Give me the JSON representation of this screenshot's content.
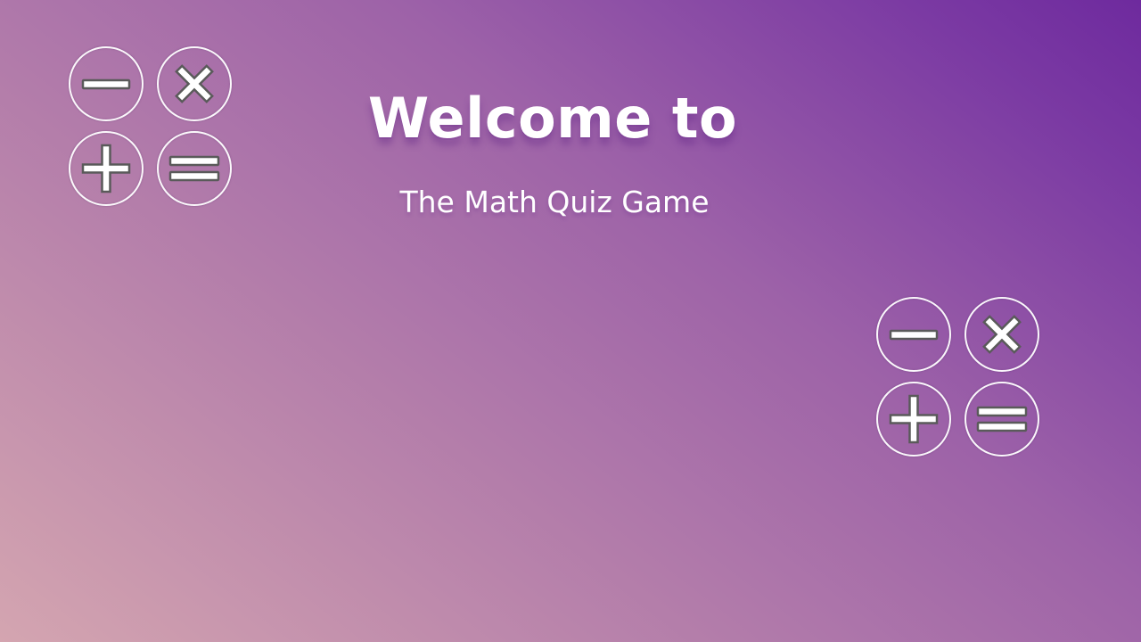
{
  "screen": {
    "title": "Welcome to",
    "subtitle": "The Math Quiz Game"
  },
  "decorations": {
    "icons": [
      "minus-icon",
      "times-icon",
      "plus-icon",
      "equals-icon"
    ],
    "circle_color": "#ffffff",
    "glyph_fill": "#ffffff",
    "glyph_stroke": "#5a5a5a"
  },
  "colors": {
    "background_start": "#d4a5b0",
    "background_end": "#6e2a9e",
    "text": "#ffffff"
  }
}
